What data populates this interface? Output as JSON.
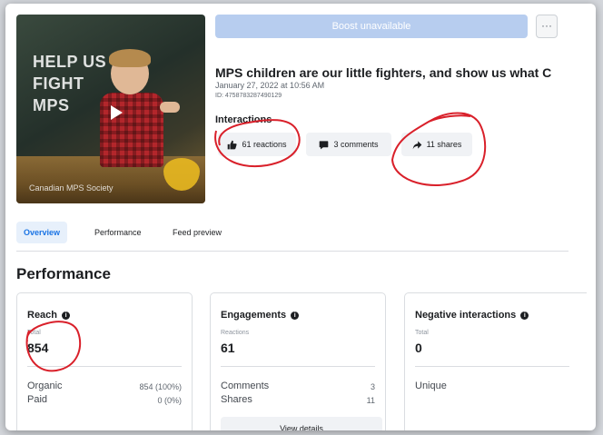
{
  "thumbnail": {
    "headline_lines": [
      "HELP US",
      "FIGHT",
      "MPS"
    ],
    "org_name": "Canadian MPS Society"
  },
  "header": {
    "boost_label": "Boost unavailable",
    "more_label": "···"
  },
  "post": {
    "title": "MPS children are our little fighters, and show us what C",
    "date": "January 27, 2022 at 10:56 AM",
    "id": "ID: 4758783287490129"
  },
  "interactions": {
    "label": "Interactions",
    "reactions": "61 reactions",
    "comments": "3 comments",
    "shares": "11 shares"
  },
  "tabs": {
    "overview": "Overview",
    "performance": "Performance",
    "feed_preview": "Feed preview"
  },
  "performance": {
    "heading": "Performance",
    "reach": {
      "title": "Reach",
      "sub": "Total",
      "value": "854",
      "rows": [
        {
          "label": "Organic",
          "value": "854 (100%)"
        },
        {
          "label": "Paid",
          "value": "0 (0%)"
        }
      ]
    },
    "engagements": {
      "title": "Engagements",
      "sub": "Reactions",
      "value": "61",
      "rows": [
        {
          "label": "Comments",
          "value": "3"
        },
        {
          "label": "Shares",
          "value": "11"
        }
      ],
      "button": "View details"
    },
    "negative": {
      "title": "Negative interactions",
      "sub": "Total",
      "value": "0",
      "rows": [
        {
          "label": "Unique"
        }
      ]
    }
  },
  "colors": {
    "accent": "#1b74e4",
    "boost_disabled": "#b7cdef",
    "annotation": "#d9202a"
  }
}
